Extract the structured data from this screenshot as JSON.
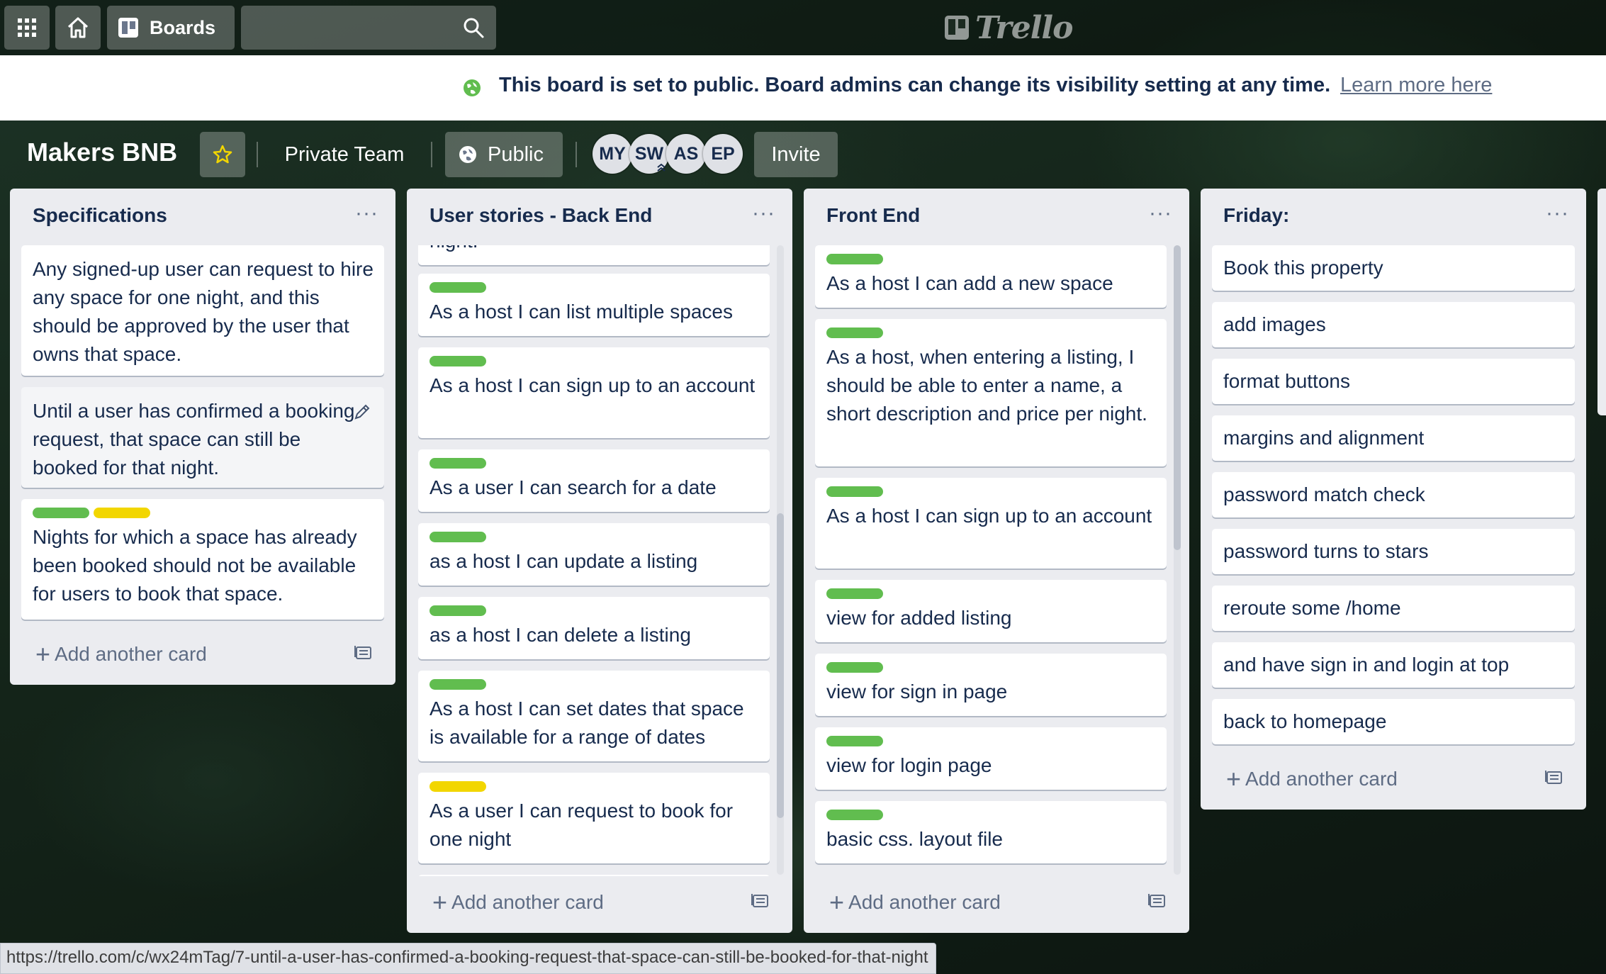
{
  "topbar": {
    "boards_label": "Boards",
    "search_value": "",
    "logo_text": "Trello"
  },
  "banner": {
    "message": "This board is set to public. Board admins can change its visibility setting at any time.",
    "learn_more": "Learn more here"
  },
  "board": {
    "title": "Makers BNB",
    "team": "Private Team",
    "visibility": "Public",
    "members": [
      "MY",
      "SW",
      "AS",
      "EP"
    ],
    "invite": "Invite"
  },
  "lists": [
    {
      "title": "Specifications",
      "menu": "···",
      "add_card": "Add another card",
      "cards": [
        {
          "text": "Any signed-up user can request to hire any space for one night, and this should be approved by the user that owns that space.",
          "labels": []
        },
        {
          "text": "Until a user has confirmed a booking request, that space can still be booked for that night.",
          "labels": []
        },
        {
          "text": "Nights for which a space has already been booked should not be available for users to book that space.",
          "labels": [
            "green",
            "yellow"
          ]
        }
      ]
    },
    {
      "title": "User stories - Back End",
      "menu": "···",
      "add_card": "Add another card",
      "cards": [
        {
          "text": "night.",
          "labels": []
        },
        {
          "text": "As a host I can list multiple spaces",
          "labels": [
            "green"
          ]
        },
        {
          "text": "As a host I can sign up to an account",
          "labels": [
            "green"
          ]
        },
        {
          "text": "As a user I can search for a date",
          "labels": [
            "green"
          ]
        },
        {
          "text": "as a host I can update a listing",
          "labels": [
            "green"
          ]
        },
        {
          "text": "as a host I can delete a listing",
          "labels": [
            "green"
          ]
        },
        {
          "text": "As a host I can set dates that space is available for a range of dates",
          "labels": [
            "green"
          ]
        },
        {
          "text": "As a user I can request to book for one night",
          "labels": [
            "yellow"
          ]
        }
      ]
    },
    {
      "title": "Front End",
      "menu": "···",
      "add_card": "Add another card",
      "cards": [
        {
          "text": "As a host I can add a new space",
          "labels": [
            "green"
          ]
        },
        {
          "text": "As a host, when entering a listing, I should be able to enter a name, a short description and price per night.",
          "labels": [
            "green"
          ]
        },
        {
          "text": "As a host I can sign up to an account",
          "labels": [
            "green"
          ]
        },
        {
          "text": "view for added listing",
          "labels": [
            "green"
          ]
        },
        {
          "text": "view for sign in page",
          "labels": [
            "green"
          ]
        },
        {
          "text": "view for login page",
          "labels": [
            "green"
          ]
        },
        {
          "text": "basic css. layout file",
          "labels": [
            "green"
          ]
        }
      ]
    },
    {
      "title": "Friday:",
      "menu": "···",
      "add_card": "Add another card",
      "cards": [
        {
          "text": "Book this property",
          "labels": []
        },
        {
          "text": "add images",
          "labels": []
        },
        {
          "text": "format buttons",
          "labels": []
        },
        {
          "text": "margins and alignment",
          "labels": []
        },
        {
          "text": "password match check",
          "labels": []
        },
        {
          "text": "password turns to stars",
          "labels": []
        },
        {
          "text": "reroute some /home",
          "labels": []
        },
        {
          "text": "and have sign in and login at top",
          "labels": []
        },
        {
          "text": "back to homepage",
          "labels": []
        }
      ]
    }
  ],
  "colors": {
    "label_green": "#61bd4f",
    "label_yellow": "#f2d600",
    "list_bg": "#ebecf0"
  },
  "status_url": "https://trello.com/c/wx24mTag/7-until-a-user-has-confirmed-a-booking-request-that-space-can-still-be-booked-for-that-night"
}
